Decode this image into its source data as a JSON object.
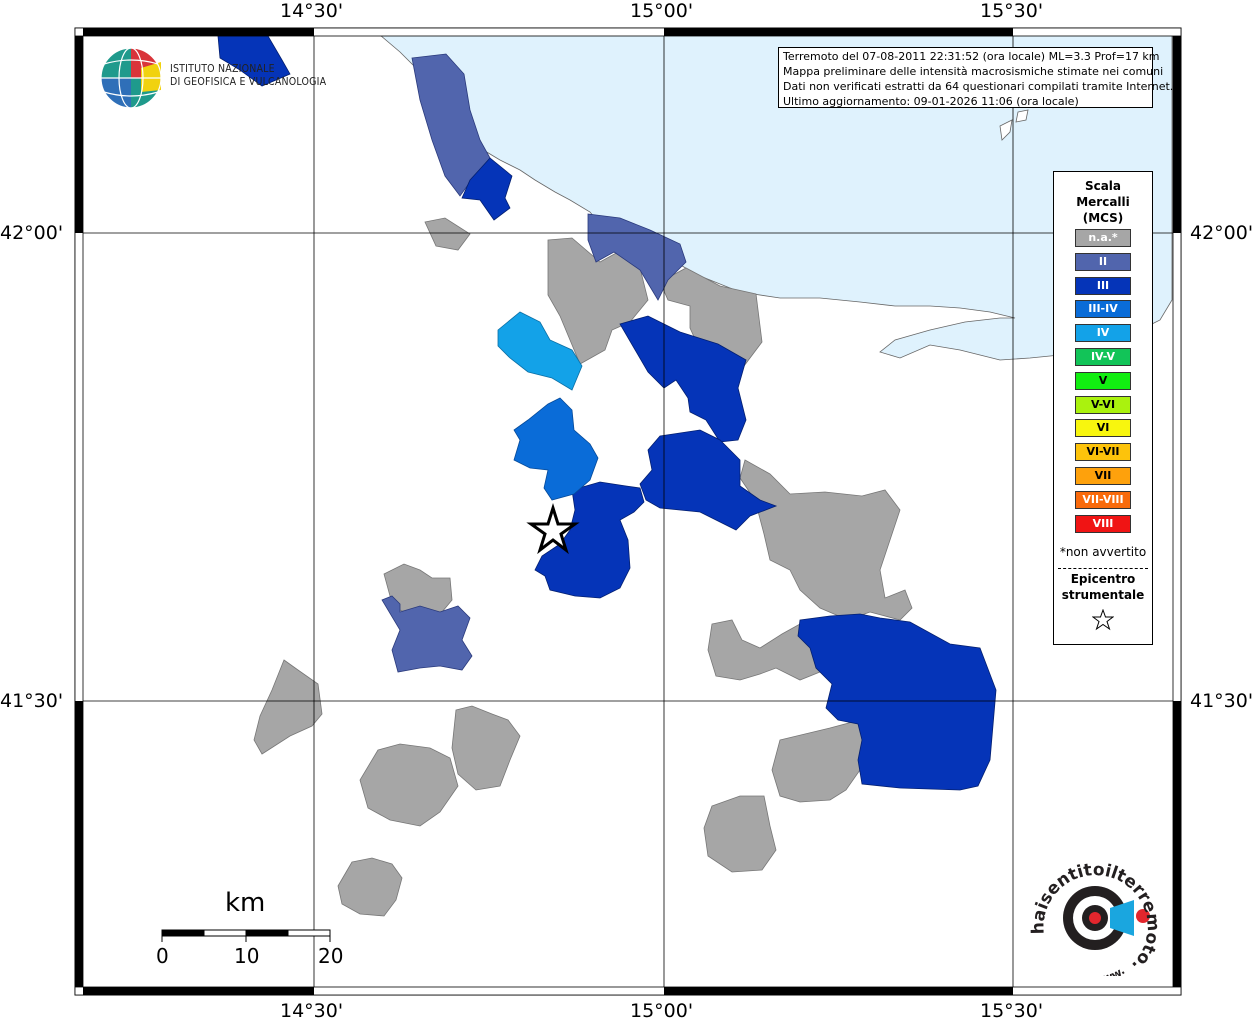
{
  "map": {
    "lon_labels": [
      "14°30'",
      "15°00'",
      "15°30'"
    ],
    "lat_labels": [
      "42°00'",
      "41°30'"
    ]
  },
  "logo": {
    "line1": "ISTITUTO NAZIONALE",
    "line2": "DI GEOFISICA E VULCANOLOGIA"
  },
  "info": {
    "line1": "Terremoto del 07-08-2011 22:31:52 (ora locale) ML=3.3 Prof=17 km",
    "line2": "Mappa preliminare delle intensità macrosismiche stimate nei comuni",
    "line3": "Dati non verificati estratti da 64 questionari compilati tramite Internet.",
    "line4": "Ultimo aggiornamento: 09-01-2026 11:06 (ora locale)"
  },
  "legend": {
    "title_line1": "Scala",
    "title_line2": "Mercalli",
    "title_line3": "(MCS)",
    "items": [
      {
        "label": "n.a.*",
        "color": "#a6a6a6"
      },
      {
        "label": "II",
        "color": "#5165ad"
      },
      {
        "label": "III",
        "color": "#0534b8"
      },
      {
        "label": "III-IV",
        "color": "#0a6cd8"
      },
      {
        "label": "IV",
        "color": "#13a2e8"
      },
      {
        "label": "IV-V",
        "color": "#12c458"
      },
      {
        "label": "V",
        "color": "#11ee11"
      },
      {
        "label": "V-VI",
        "color": "#aaf20e"
      },
      {
        "label": "VI",
        "color": "#f8f60e"
      },
      {
        "label": "VI-VII",
        "color": "#fdc30b"
      },
      {
        "label": "VII",
        "color": "#fea10c"
      },
      {
        "label": "VII-VIII",
        "color": "#f96a0b"
      },
      {
        "label": "VIII",
        "color": "#f01414"
      }
    ],
    "note": "*non avvertito",
    "epicenter_line1": "Epicentro",
    "epicenter_line2": "strumentale"
  },
  "scale_bar": {
    "unit": "km",
    "ticks": [
      "0",
      "10",
      "20"
    ]
  },
  "brand": {
    "text": "haisentitoilterremoto.it",
    "url": "www."
  },
  "colors": {
    "sea": "#dff2fd",
    "na": "#a6a6a6",
    "ii": "#5165ad",
    "iii": "#0534b8",
    "iii_iv": "#0a6cd8",
    "iv": "#13a2e8"
  }
}
